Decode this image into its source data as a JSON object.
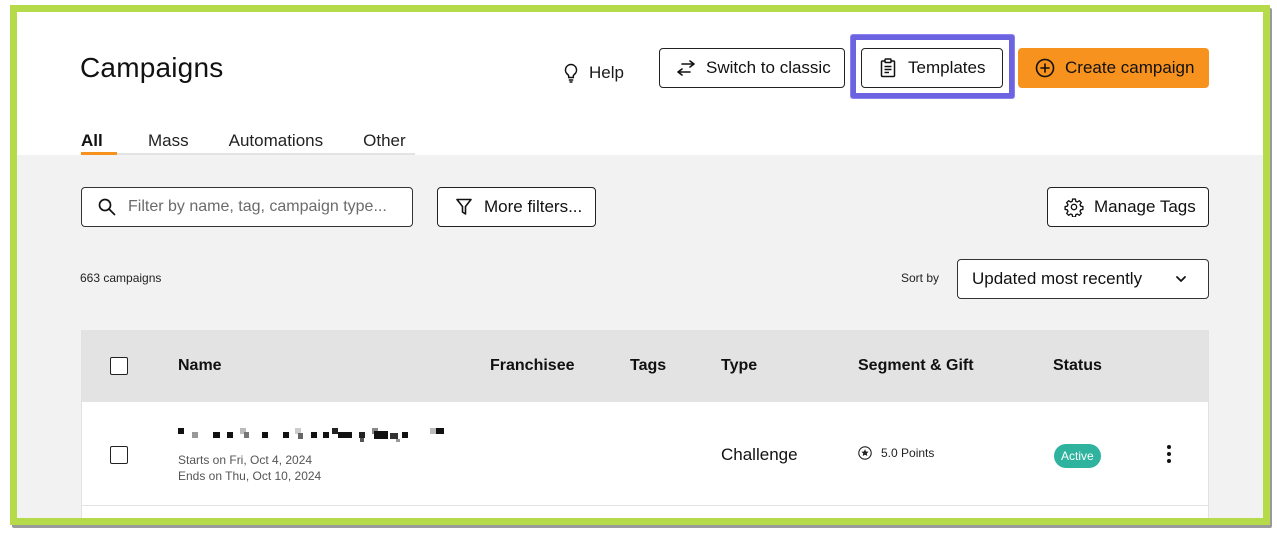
{
  "header": {
    "title": "Campaigns",
    "help_label": "Help",
    "switch_label": "Switch to classic",
    "templates_label": "Templates",
    "create_label": "Create campaign"
  },
  "tabs": [
    {
      "label": "All",
      "active": true
    },
    {
      "label": "Mass",
      "active": false
    },
    {
      "label": "Automations",
      "active": false
    },
    {
      "label": "Other",
      "active": false
    }
  ],
  "filters": {
    "search_placeholder": "Filter by name, tag, campaign type...",
    "more_filters_label": "More filters...",
    "manage_tags_label": "Manage Tags"
  },
  "list": {
    "count_text": "663 campaigns",
    "sort_label": "Sort by",
    "sort_value": "Updated most recently"
  },
  "table": {
    "columns": [
      "Name",
      "Franchisee",
      "Tags",
      "Type",
      "Segment & Gift",
      "Status"
    ],
    "rows": [
      {
        "name": "",
        "starts": "Starts on Fri, Oct 4, 2024",
        "ends": "Ends on Thu, Oct 10, 2024",
        "franchisee": "",
        "tags": "",
        "type": "Challenge",
        "segment_gift": "5.0 Points",
        "status": "Active"
      }
    ]
  },
  "colors": {
    "accent": "#f7921e",
    "highlight": "#6c63e0",
    "frame": "#b5db4a",
    "status_active": "#2fb39f"
  },
  "icons": [
    "lightbulb-icon",
    "swap-arrows-icon",
    "clipboard-icon",
    "plus-circle-icon",
    "search-icon",
    "filter-icon",
    "gear-icon",
    "chevron-down-icon",
    "star-icon",
    "more-vertical-icon"
  ]
}
